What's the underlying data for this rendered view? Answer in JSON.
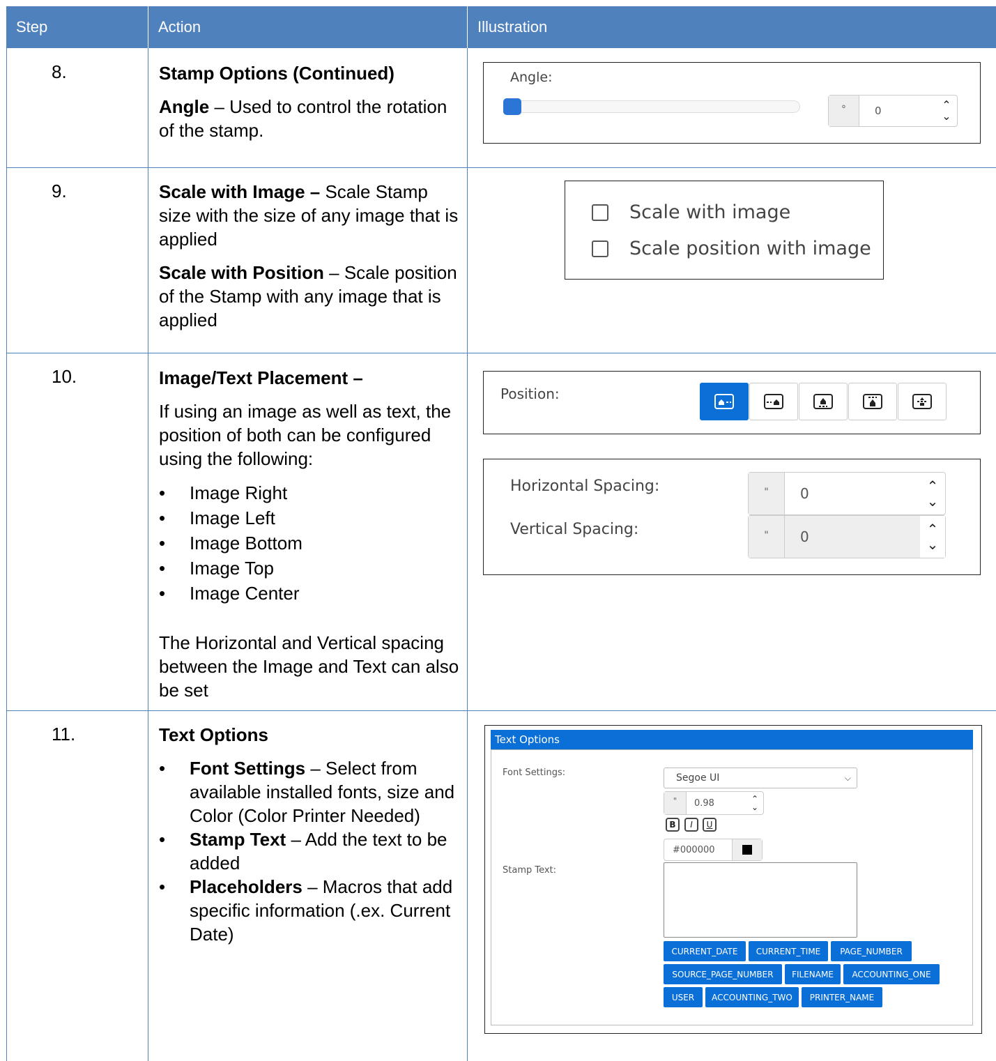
{
  "header": {
    "step": "Step",
    "action": "Action",
    "illustration": "Illustration"
  },
  "rows": [
    {
      "num": "8.",
      "title": "Stamp Options (Continued)",
      "desc_bold": "Angle",
      "desc_rest": " – Used to control the rotation of the stamp.",
      "illustration": {
        "label": "Angle:",
        "unit": "°",
        "value": "0",
        "slider_fraction": 0
      }
    },
    {
      "num": "9.",
      "p1_bold": "Scale with Image –",
      "p1_rest": " Scale Stamp size with the size of any image that is applied",
      "p2_bold": "Scale with Position",
      "p2_rest": " – Scale position of the Stamp with any image that is applied",
      "illustration": {
        "checkbox1": "Scale with image",
        "checkbox2": "Scale position with image"
      }
    },
    {
      "num": "10.",
      "title": "Image/Text Placement –",
      "intro": "If using an image as well as text, the position of both can be configured using the following:",
      "bullets": [
        "Image Right",
        "Image Left",
        "Image Bottom",
        "Image Top",
        "Image Center"
      ],
      "outro": "The Horizontal and Vertical spacing between the Image and Text can also be set",
      "illustration": {
        "position_label": "Position:",
        "position_icons": [
          "image-left-icon",
          "image-right-icon",
          "image-bottom-icon",
          "image-top-icon",
          "image-center-icon"
        ],
        "active_position": 0,
        "h_label": "Horizontal Spacing:",
        "v_label": "Vertical Spacing:",
        "unit": "\"",
        "h_value": "0",
        "v_value": "0"
      }
    },
    {
      "num": "11.",
      "title": "Text Options",
      "bullets": [
        {
          "bold": "Font Settings",
          "rest": " – Select from available installed fonts, size and Color (Color Printer Needed)"
        },
        {
          "bold": "Stamp Text",
          "rest": " – Add the text to be added"
        },
        {
          "bold": "Placeholders",
          "rest": " – Macros that add specific information (.ex. Current Date)"
        }
      ],
      "illustration": {
        "panel_title": "Text Options",
        "font_label": "Font Settings:",
        "font_value": "Segoe UI",
        "size_unit": "\"",
        "size_value": "0.98",
        "bold": "B",
        "italic": "I",
        "underline": "U",
        "color_value": "#000000",
        "stamp_text_label": "Stamp Text:",
        "placeholders": [
          [
            "CURRENT_DATE",
            "CURRENT_TIME",
            "PAGE_NUMBER"
          ],
          [
            "SOURCE_PAGE_NUMBER",
            "FILENAME",
            "ACCOUNTING_ONE"
          ],
          [
            "USER",
            "ACCOUNTING_TWO",
            "PRINTER_NAME"
          ]
        ]
      }
    }
  ],
  "colors": {
    "header_bg": "#4f81bd",
    "accent": "#0b6fd8"
  }
}
